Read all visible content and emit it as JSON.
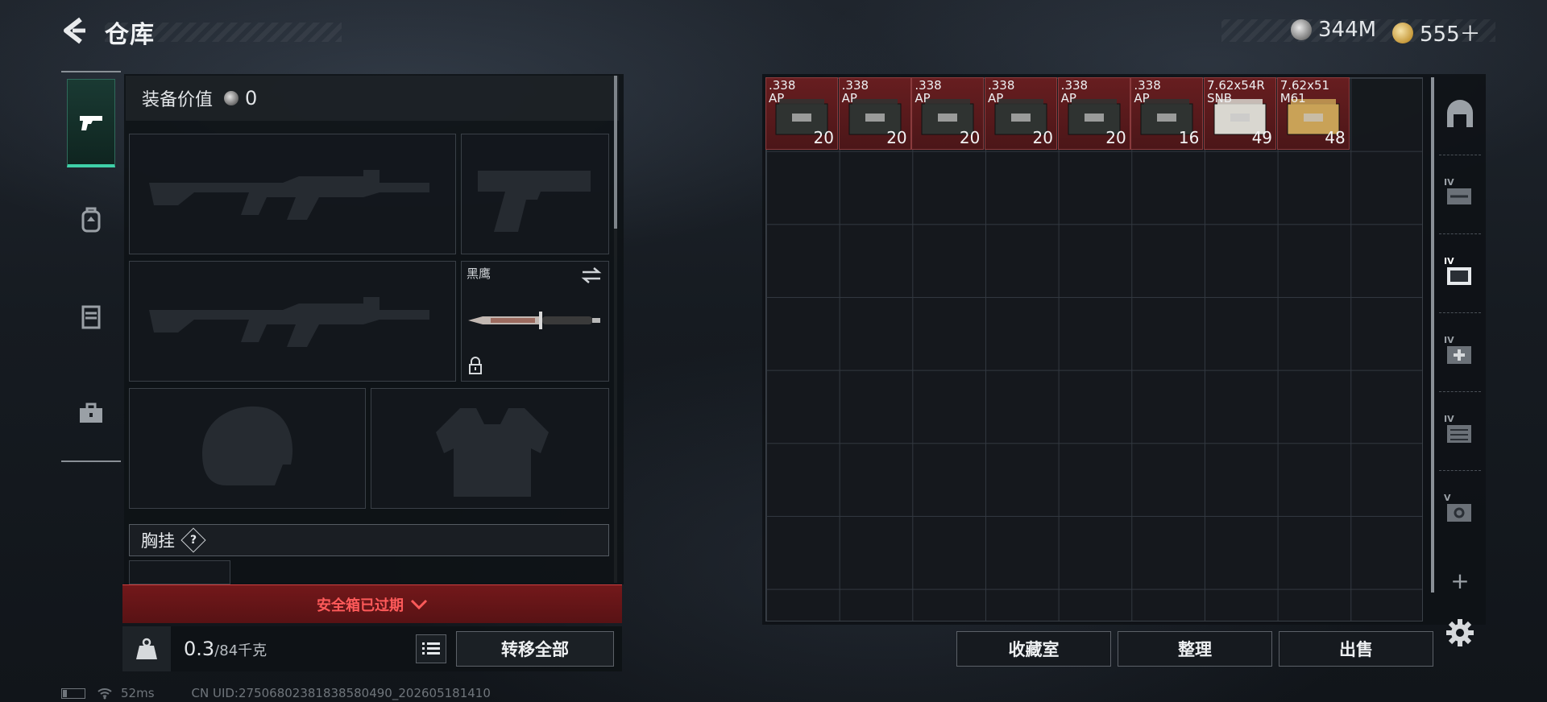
{
  "header": {
    "title": "仓库",
    "currencies": [
      {
        "icon": "silver-coin-icon",
        "value": "344M"
      },
      {
        "icon": "gold-coin-icon",
        "value": "555＋"
      }
    ]
  },
  "left_nav": {
    "tabs": [
      {
        "icon": "pistol-icon",
        "active": true
      },
      {
        "icon": "backpack-icon",
        "active": false
      },
      {
        "icon": "chest-rig-icon",
        "active": false
      },
      {
        "icon": "toolbox-icon",
        "active": false
      }
    ]
  },
  "equipment": {
    "value_label": "装备价值",
    "value": "0",
    "slots": {
      "primary_1": {
        "icon": "assault-rifle-silhouette"
      },
      "pistol": {
        "icon": "pistol-silhouette"
      },
      "primary_2": {
        "icon": "assault-rifle-silhouette"
      },
      "melee": {
        "label": "黑鹰",
        "icon": "knife-icon",
        "locked": true
      },
      "helmet": {
        "icon": "helmet-silhouette"
      },
      "armor": {
        "icon": "vest-silhouette"
      }
    },
    "chest_rig_label": "胸挂",
    "chest_rig_help": "?",
    "secure_container_status": "安全箱已过期",
    "weight": {
      "current": "0.3",
      "max": "/84千克"
    },
    "transfer_all_label": "转移全部"
  },
  "storage": {
    "items": [
      {
        "name": ".338\nAP",
        "qty": "20",
        "color": "#2f3331"
      },
      {
        "name": ".338\nAP",
        "qty": "20",
        "color": "#2f3331"
      },
      {
        "name": ".338\nAP",
        "qty": "20",
        "color": "#2f3331"
      },
      {
        "name": ".338\nAP",
        "qty": "20",
        "color": "#2f3331"
      },
      {
        "name": ".338\nAP",
        "qty": "20",
        "color": "#2f3331"
      },
      {
        "name": ".338\nAP",
        "qty": "16",
        "color": "#2f3331"
      },
      {
        "name": "7.62x54R\nSNB",
        "qty": "49",
        "color": "#d9d7d0"
      },
      {
        "name": "7.62x51\nM61",
        "qty": "48",
        "color": "#c9a257"
      }
    ],
    "side_tabs": [
      {
        "icon": "storage-home-icon",
        "tier": ""
      },
      {
        "icon": "weapon-case-icon",
        "tier": "IV"
      },
      {
        "icon": "item-case-icon",
        "tier": "IV"
      },
      {
        "icon": "medical-case-icon",
        "tier": "IV"
      },
      {
        "icon": "ammo-case-icon",
        "tier": "IV"
      },
      {
        "icon": "valuables-case-icon",
        "tier": "V"
      }
    ],
    "buttons": {
      "collection": "收藏室",
      "sort": "整理",
      "sell": "出售"
    }
  },
  "status_bar": {
    "ping": "52ms",
    "uid": "CN UID:27506802381838580490_202605181410"
  },
  "colors": {
    "accent": "#3fd0a8",
    "warning": "#ff5a5a",
    "expired_bg": "#781a1c"
  }
}
